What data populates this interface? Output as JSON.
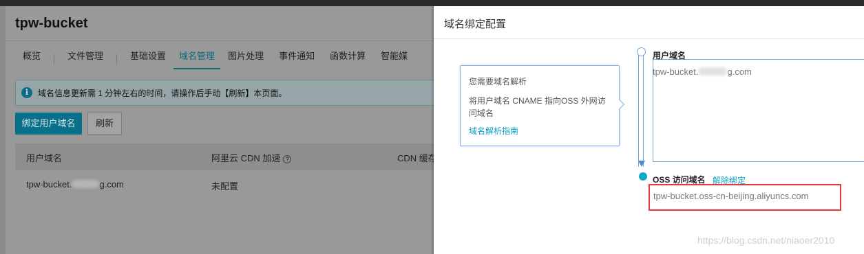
{
  "page": {
    "title": "tpw-bucket",
    "tabs": [
      {
        "label": "概览"
      },
      {
        "label": "文件管理"
      },
      {
        "label": "基础设置"
      },
      {
        "label": "域名管理"
      },
      {
        "label": "图片处理"
      },
      {
        "label": "事件通知"
      },
      {
        "label": "函数计算"
      },
      {
        "label": "智能媒"
      }
    ],
    "notice": "域名信息更新需 1 分钟左右的时间，请操作后手动【刷新】本页面。",
    "bind_button": "绑定用户域名",
    "refresh_button": "刷新",
    "table": {
      "headers": [
        "用户域名",
        "阿里云 CDN 加速",
        "CDN 缓存"
      ],
      "row": {
        "domain_prefix": "tpw-bucket.",
        "domain_suffix": "g.com",
        "cdn_status": "未配置"
      }
    }
  },
  "drawer": {
    "title": "域名绑定配置",
    "tip": {
      "line1": "您需要域名解析",
      "line2": "将用户域名 CNAME 指向OSS 外网访问域名",
      "link": "域名解析指南"
    },
    "user_domain": {
      "label": "用户域名",
      "value_prefix": "tpw-bucket.",
      "value_suffix": "g.com"
    },
    "oss_domain": {
      "label": "OSS 访问域名",
      "unbind_link": "解除绑定",
      "value": "tpw-bucket.oss-cn-beijing.aliyuncs.com"
    }
  },
  "watermark": "https://blog.csdn.net/niaoer2010",
  "colors": {
    "accent": "#0fa9c9",
    "primary_button": "#08708a",
    "highlight_box": "#e8383d",
    "flow_line": "#6fa4dc"
  },
  "icons": {
    "notice": "info-icon",
    "cdn_help": "question-circle-icon"
  }
}
